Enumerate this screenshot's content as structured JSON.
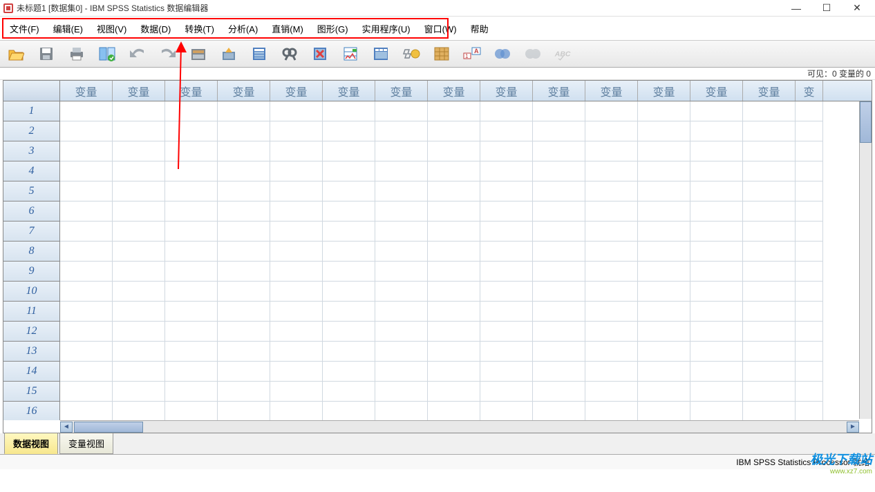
{
  "title": "未标题1 [数据集0] - IBM SPSS Statistics 数据编辑器",
  "menu": {
    "file": "文件(F)",
    "edit": "编辑(E)",
    "view": "视图(V)",
    "data": "数据(D)",
    "transform": "转换(T)",
    "analyze": "分析(A)",
    "direct": "直销(M)",
    "graphs": "图形(G)",
    "utilities": "实用程序(U)",
    "window": "窗口(W)",
    "help": "帮助"
  },
  "toolbar_icons": [
    "open-file-icon",
    "save-icon",
    "print-icon",
    "recall-dialog-icon",
    "undo-icon",
    "redo-icon",
    "goto-case-icon",
    "goto-variable-icon",
    "variables-icon",
    "find-icon",
    "insert-case-icon",
    "split-file-icon",
    "weight-cases-icon",
    "select-cases-icon",
    "value-labels-icon",
    "use-sets-icon",
    "show-all-icon",
    "spell-check-icon",
    "abc-icon"
  ],
  "visible_text": "可见：0 变量的 0",
  "column_header": "变量",
  "col_last": "变",
  "rows": [
    "1",
    "2",
    "3",
    "4",
    "5",
    "6",
    "7",
    "8",
    "9",
    "10",
    "11",
    "12",
    "13",
    "14",
    "15",
    "16"
  ],
  "tabs": {
    "data_view": "数据视图",
    "var_view": "变量视图"
  },
  "status": "IBM SPSS Statistics Processor 就绪",
  "watermark": {
    "line1": "极光下载站",
    "line2": "www.xz7.com"
  }
}
